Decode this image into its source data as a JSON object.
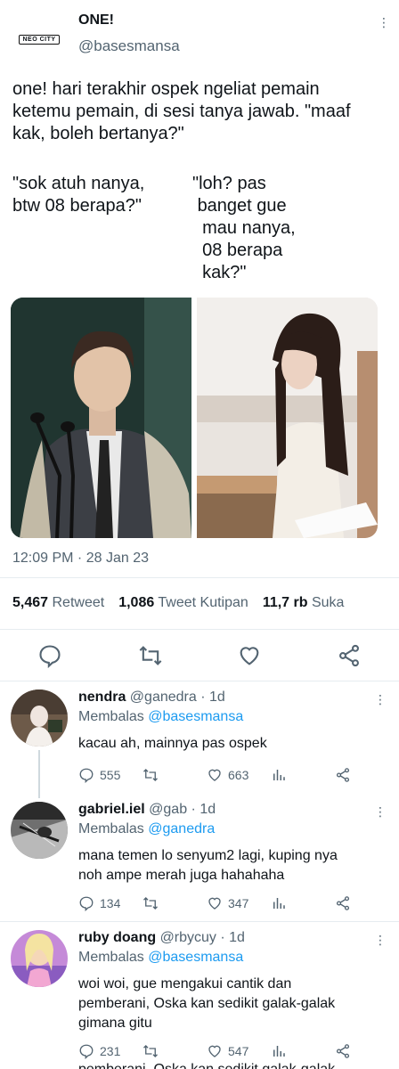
{
  "tweet": {
    "name": "ONE!",
    "handle": "@basesmansa",
    "logo_text": "NEO CITY",
    "text_line1": "one! hari terakhir ospek ngeliat pemain\nketemu pemain, di sesi tanya jawab. \"maaf\nkak, boleh bertanya?\"",
    "left_quote": "\"sok atuh nanya,\nbtw 08 berapa?\"",
    "right_quote": "\"loh? pas\n banget gue\n  mau nanya,\n  08 berapa\n  kak?\"",
    "timestamp": "12:09 PM · 28 Jan 23",
    "stats": {
      "retweets": "5,467",
      "retweets_label": "Retweet",
      "quotes": "1,086",
      "quotes_label": "Tweet Kutipan",
      "likes": "11,7 rb",
      "likes_label": "Suka"
    }
  },
  "replies": [
    {
      "name": "nendra",
      "handle": "@ganedra · 1d",
      "to_prefix": "Membalas",
      "to_handle": "@basesmansa",
      "text": "kacau ah, mainnya pas ospek",
      "replies_count": "555",
      "likes_count": "663"
    },
    {
      "name": "gabriel.iel",
      "handle": "@gab · 1d",
      "to_prefix": "Membalas",
      "to_handle": "@ganedra",
      "text": "mana temen lo senyum2 lagi, kuping nya\nnoh ampe merah juga hahahaha",
      "replies_count": "134",
      "likes_count": "347"
    },
    {
      "name": "ruby doang",
      "handle": "@rbycuy · 1d",
      "to_prefix": "Membalas",
      "to_handle": "@basesmansa",
      "text": "woi woi, gue mengakui cantik dan\npemberani, Oska kan sedikit galak-galak\ngimana gitu",
      "replies_count": "231",
      "likes_count": "547"
    }
  ],
  "cut_off_text": "pemberani, Oska kan sedikit galak-galak",
  "colors": {
    "accent": "#1d9bf0",
    "muted": "#536471",
    "text": "#0f1419",
    "divider": "#e6ecf0"
  }
}
